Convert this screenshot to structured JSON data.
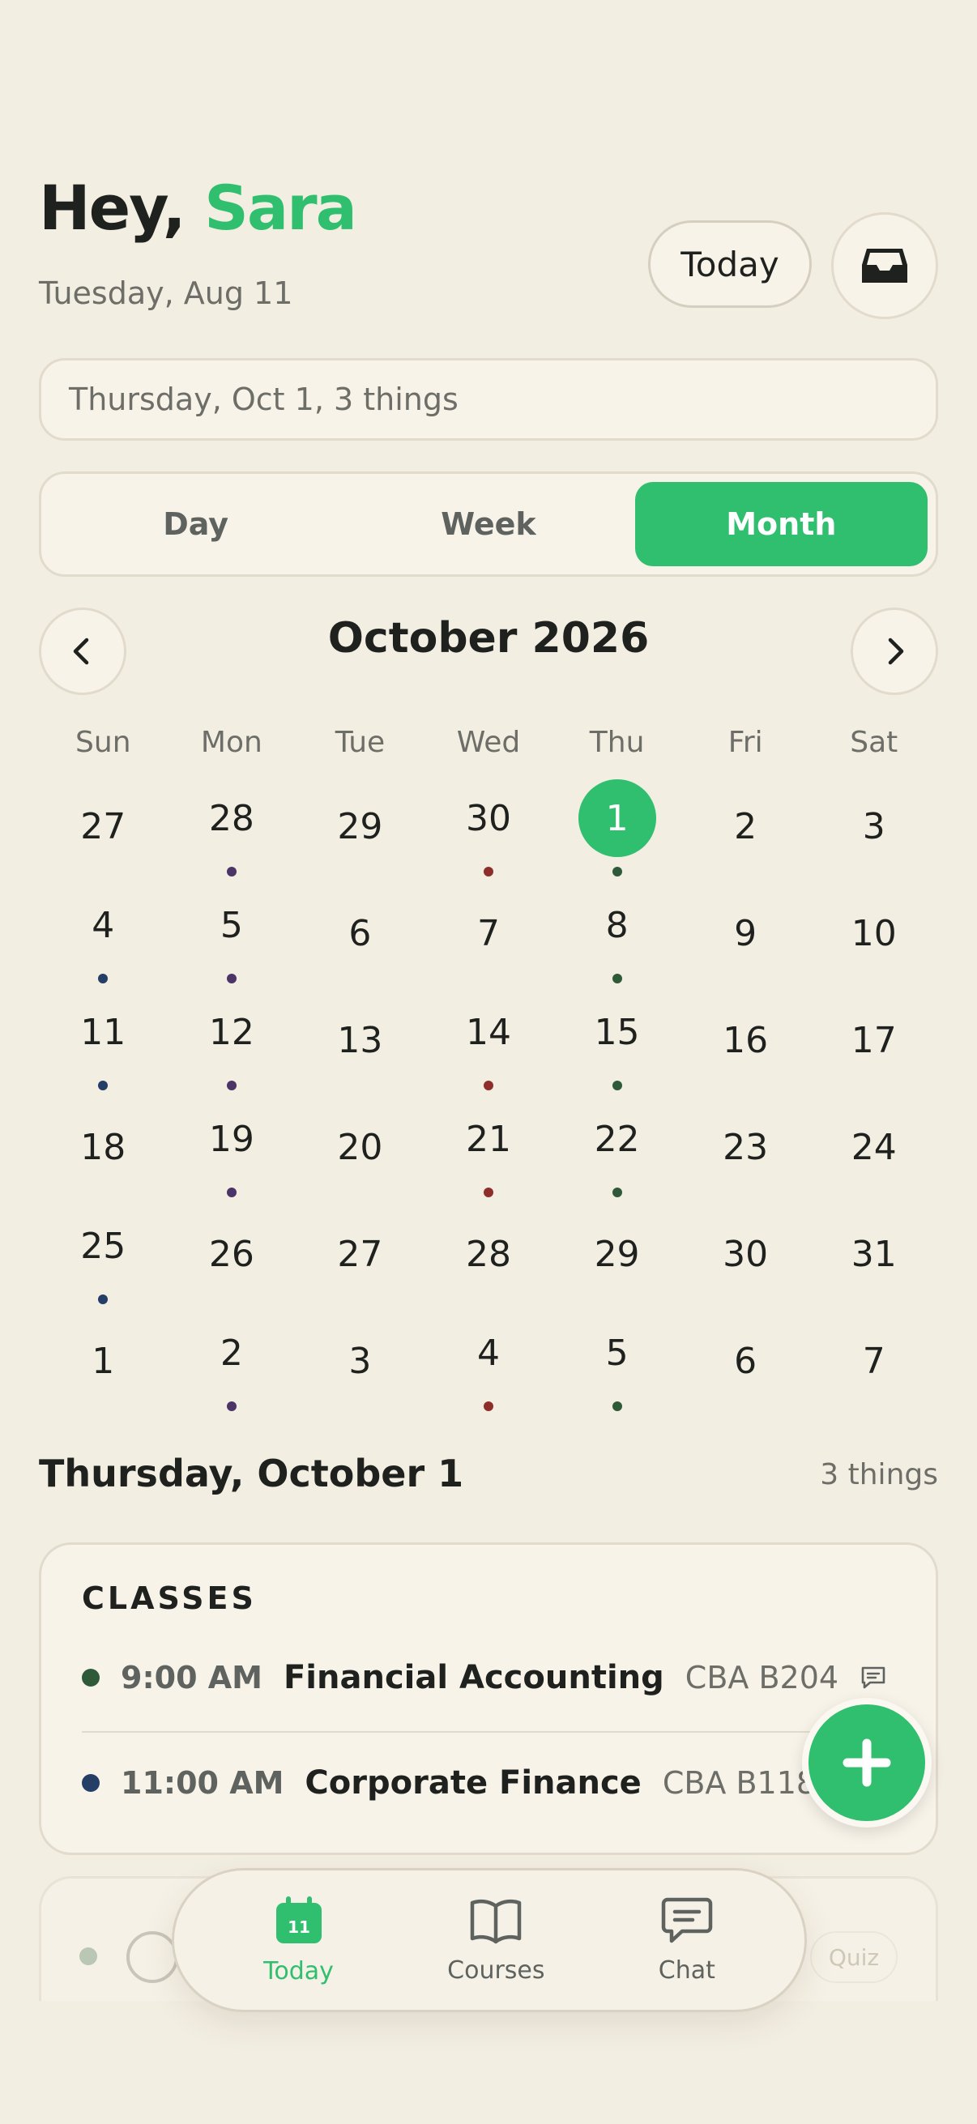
{
  "header": {
    "greeting": "Hey,",
    "user_name": "Sara",
    "date": "Tuesday, Aug 11",
    "today_button": "Today",
    "inbox_icon": "inbox-icon"
  },
  "search": {
    "value": "Thursday, Oct 1, 3 things"
  },
  "view_switcher": {
    "options": [
      "Day",
      "Week",
      "Month"
    ],
    "selected": "Month"
  },
  "calendar": {
    "month_label": "October 2026",
    "weekdays": [
      "Sun",
      "Mon",
      "Tue",
      "Wed",
      "Thu",
      "Fri",
      "Sat"
    ],
    "selected_day": "1",
    "days": [
      {
        "d": "27"
      },
      {
        "d": "28",
        "dot": "#4B3466"
      },
      {
        "d": "29"
      },
      {
        "d": "30",
        "dot": "#8E2E2B"
      },
      {
        "d": "1",
        "dot": "#2E5A3A",
        "selected": true
      },
      {
        "d": "2"
      },
      {
        "d": "3"
      },
      {
        "d": "4",
        "dot": "#243E66"
      },
      {
        "d": "5",
        "dot": "#4B3466"
      },
      {
        "d": "6"
      },
      {
        "d": "7"
      },
      {
        "d": "8",
        "dot": "#2E5A3A"
      },
      {
        "d": "9"
      },
      {
        "d": "10"
      },
      {
        "d": "11",
        "dot": "#243E66"
      },
      {
        "d": "12",
        "dot": "#4B3466"
      },
      {
        "d": "13"
      },
      {
        "d": "14",
        "dot": "#8E2E2B"
      },
      {
        "d": "15",
        "dot": "#2E5A3A"
      },
      {
        "d": "16"
      },
      {
        "d": "17"
      },
      {
        "d": "18"
      },
      {
        "d": "19",
        "dot": "#4B3466"
      },
      {
        "d": "20"
      },
      {
        "d": "21",
        "dot": "#8E2E2B"
      },
      {
        "d": "22",
        "dot": "#2E5A3A"
      },
      {
        "d": "23"
      },
      {
        "d": "24"
      },
      {
        "d": "25",
        "dot": "#243E66"
      },
      {
        "d": "26"
      },
      {
        "d": "27"
      },
      {
        "d": "28"
      },
      {
        "d": "29"
      },
      {
        "d": "30"
      },
      {
        "d": "31"
      },
      {
        "d": "1"
      },
      {
        "d": "2",
        "dot": "#4B3466"
      },
      {
        "d": "3"
      },
      {
        "d": "4",
        "dot": "#8E2E2B"
      },
      {
        "d": "5",
        "dot": "#2E5A3A"
      },
      {
        "d": "6"
      },
      {
        "d": "7"
      }
    ]
  },
  "day_section": {
    "title": "Thursday, October 1",
    "count": "3 things",
    "classes_heading": "CLASSES",
    "classes": [
      {
        "time": "9:00 AM",
        "title": "Financial Accounting",
        "room": "CBA B204",
        "color": "#2E5A3A"
      },
      {
        "time": "11:00 AM",
        "title": "Corporate Finance",
        "room": "CBA B118",
        "color": "#243E66"
      }
    ],
    "next_badge": "Quiz"
  },
  "tab_bar": {
    "today_badge": "11",
    "tabs": [
      {
        "label": "Today",
        "icon": "calendar-icon",
        "active": true
      },
      {
        "label": "Courses",
        "icon": "book-icon",
        "active": false
      },
      {
        "label": "Chat",
        "icon": "chat-icon",
        "active": false
      }
    ]
  },
  "colors": {
    "accent": "#2FBF6E",
    "background": "#F3EEE2",
    "card": "#F8F3E9"
  }
}
